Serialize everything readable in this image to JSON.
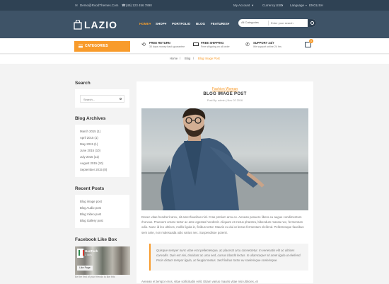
{
  "topbar": {
    "email": "Demo@RoodThemes.Com",
    "phone": "(49) 123 456 7890",
    "account": "My Account",
    "currency_label": "Currency",
    "currency_value": "USD",
    "language_label": "Language",
    "language_value": "ENGLISH"
  },
  "header": {
    "logo": "LAZIO",
    "nav": [
      {
        "label": "HOME"
      },
      {
        "label": "SHOP"
      },
      {
        "label": "PORTFOLIO"
      },
      {
        "label": "BLOG"
      },
      {
        "label": "FEATURES"
      }
    ],
    "search": {
      "category": "All Categories",
      "placeholder": "Enter your search"
    }
  },
  "features_bar": {
    "categories_label": "CATEGORIES",
    "items": [
      {
        "title": "FREE RETURN",
        "subtitle": "30 days money back guarantee"
      },
      {
        "title": "FREE SHIPPING",
        "subtitle": "Free shipping on all order"
      },
      {
        "title": "SUPPORT 24/7",
        "subtitle": "We support online 24 hrs"
      }
    ],
    "cart_count": "0"
  },
  "breadcrumb": {
    "home": "Home",
    "sep1": "/",
    "blog": "Blog",
    "sep2": "/",
    "current": "Blog Image Post"
  },
  "sidebar": {
    "search_title": "Search",
    "search_placeholder": "Search...",
    "archives_title": "Blog Archives",
    "archives": [
      "March 2015 (1)",
      "April 2015 (1)",
      "May 2015 (1)",
      "June 2015 (10)",
      "July 2015 (11)",
      "August 2015 (10)",
      "September 2015 (8)"
    ],
    "recent_title": "Recent Posts",
    "recent": [
      "Blog image post",
      "Blog Audio post",
      "Blog Video post",
      "Blog Gallery post"
    ],
    "facebook_title": "Facebook Like Box",
    "facebook": {
      "page_name": "HasTech",
      "likes": "1 likes",
      "like_button": "Like Page",
      "footer": "Be the first of your friends to like this"
    }
  },
  "post": {
    "category": "Fashion Woman",
    "title": "BLOG IMAGE POST",
    "meta": "Post By: admin  |  Nov 02 2016",
    "paragraph": "Donec vitae hendrerit arcu, sit amet faucibus nisl. Cras pretium arcu ex. Aenean posuere libero eu augue condimentum rhoncus. Praesent ornare tortor ac ante egestas hendrerit. Aliquam et metus pharetra, bibendum massa nec, fermentum odio. Nunc id leo ultrices, mollis ligula in, finibus tortor. Mauris eu dui ut lectus fermentum eleifend. Pellentesque faucibus sem ante, non malesuada odio varius nec. Suspendisse potenti.",
    "quote": "Quisque semper nunc vitae erat pellentesque, ac placerat arcu consectetur. In venenatis elit ac ultrices convallis. Duis est nisi, tincidunt ac urna sed, cursus blandit lectus. In ullamcorper sit amet ligula ut eleifend. Proin dictum tempor ligula, ac feugiat metus. Sed finibus tortor eu scelerisque scelerisque.",
    "paragraph2": "Aenean et tempor eros, vitae sollicitudin velit. Etiam varius mauris vitae nisi ultricies, et"
  },
  "colors": {
    "accent": "#f89b2b",
    "header": "#3e5367",
    "topbar": "#2f4254"
  }
}
